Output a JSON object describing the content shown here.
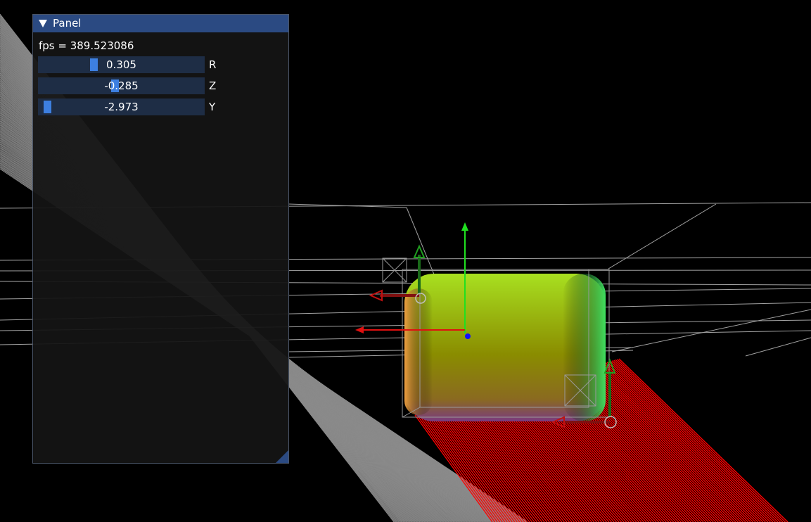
{
  "panel": {
    "title": "Panel",
    "fps_text": "fps = 389.523086",
    "sliders": [
      {
        "value_text": "0.305",
        "label": "R",
        "fraction": 0.32
      },
      {
        "value_text": "-0.285",
        "label": "Z",
        "fraction": 0.46
      },
      {
        "value_text": "-2.973",
        "label": "Y",
        "fraction": 0.02
      }
    ]
  },
  "colors": {
    "titlebar": "#2b4a82",
    "slider_track": "#1e2d45",
    "slider_grab": "#3d7fe0",
    "floor_red": "#ff0000",
    "floor_gray": "#8a8a8a",
    "axis_x": "#e01010",
    "axis_y": "#20e020",
    "axis_z": "#1010ff"
  }
}
